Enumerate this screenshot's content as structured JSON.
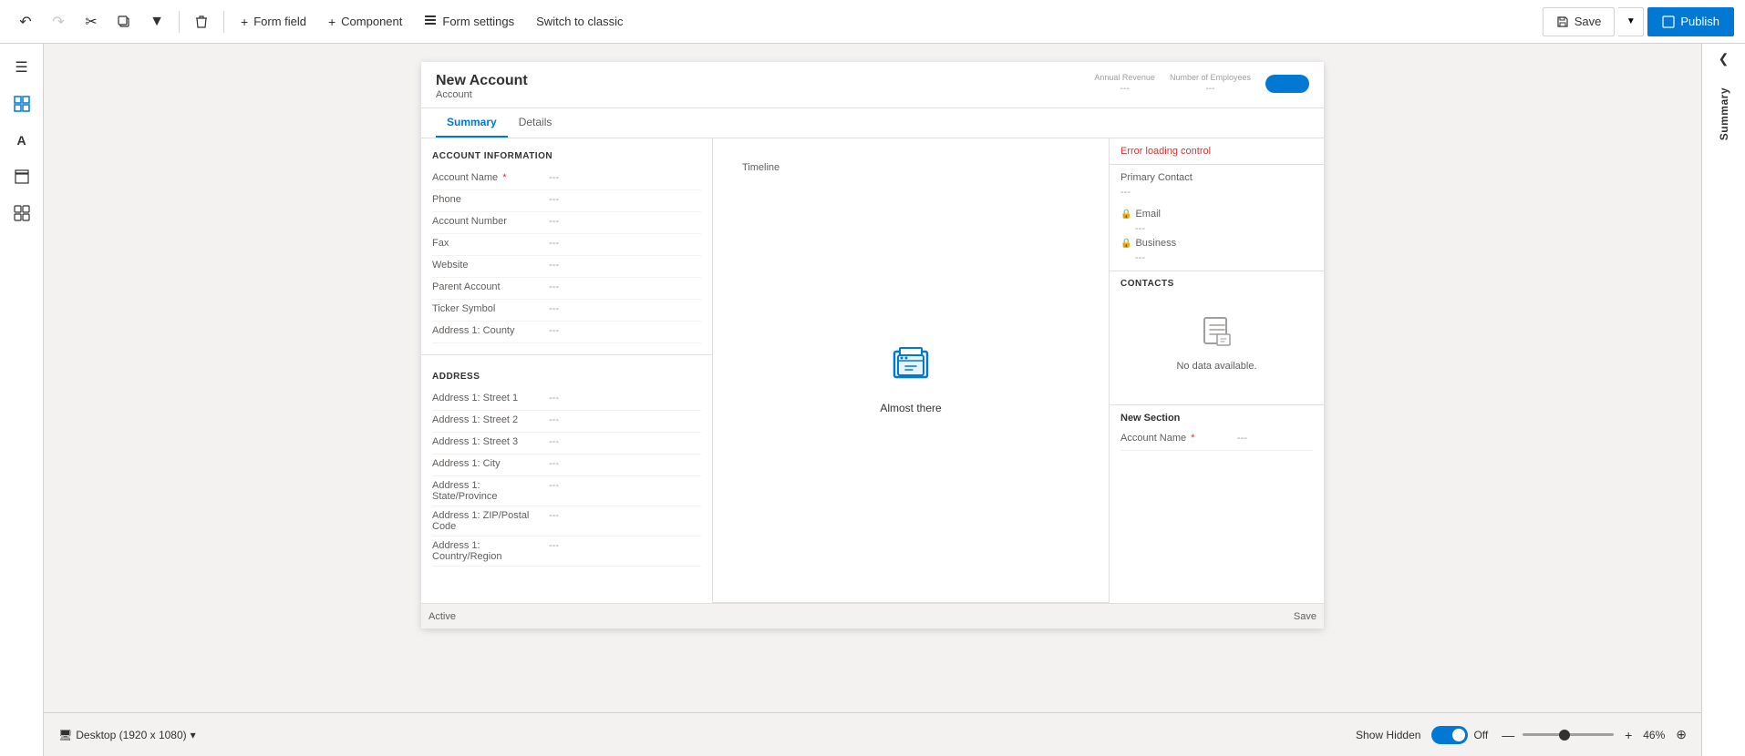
{
  "toolbar": {
    "undo_label": "↩",
    "redo_label": "↪",
    "cut_label": "✂",
    "copy_label": "⧉",
    "dropdown_label": "▾",
    "delete_label": "🗑",
    "form_field_label": "Form field",
    "component_label": "Component",
    "form_settings_label": "Form settings",
    "switch_classic_label": "Switch to classic",
    "save_label": "Save",
    "publish_label": "Publish"
  },
  "left_sidebar": {
    "icons": [
      {
        "name": "hamburger-icon",
        "symbol": "☰"
      },
      {
        "name": "grid-icon",
        "symbol": "▦"
      },
      {
        "name": "text-field-icon",
        "symbol": "A"
      },
      {
        "name": "layers-icon",
        "symbol": "◫"
      },
      {
        "name": "components-icon",
        "symbol": "⊞"
      }
    ]
  },
  "form": {
    "title": "New Account",
    "subtitle": "Account",
    "header_fields": [
      {
        "label": "Annual Revenue",
        "value": "---"
      },
      {
        "label": "Number of Employees",
        "value": "---"
      }
    ],
    "tabs": [
      {
        "label": "Summary",
        "active": true
      },
      {
        "label": "Details",
        "active": false
      }
    ],
    "sections": {
      "account_info": {
        "title": "ACCOUNT INFORMATION",
        "fields": [
          {
            "label": "Account Name",
            "required": true,
            "value": "---"
          },
          {
            "label": "Phone",
            "required": false,
            "value": "---"
          },
          {
            "label": "Account Number",
            "required": false,
            "value": "---"
          },
          {
            "label": "Fax",
            "required": false,
            "value": "---"
          },
          {
            "label": "Website",
            "required": false,
            "value": "---"
          },
          {
            "label": "Parent Account",
            "required": false,
            "value": "---"
          },
          {
            "label": "Ticker Symbol",
            "required": false,
            "value": "---"
          },
          {
            "label": "Address 1: County",
            "required": false,
            "value": "---"
          }
        ]
      },
      "address": {
        "title": "ADDRESS",
        "fields": [
          {
            "label": "Address 1: Street 1",
            "required": false,
            "value": "---"
          },
          {
            "label": "Address 1: Street 2",
            "required": false,
            "value": "---"
          },
          {
            "label": "Address 1: Street 3",
            "required": false,
            "value": "---"
          },
          {
            "label": "Address 1: City",
            "required": false,
            "value": "---"
          },
          {
            "label": "Address 1: State/Province",
            "required": false,
            "value": "---"
          },
          {
            "label": "Address 1: ZIP/Postal Code",
            "required": false,
            "value": "---"
          },
          {
            "label": "Address 1: Country/Region",
            "required": false,
            "value": "---"
          }
        ]
      }
    },
    "timeline": {
      "label": "Timeline",
      "icon": "📁",
      "text": "Almost there"
    },
    "right_panel": {
      "error_label": "Error loading control",
      "primary_contact_label": "Primary Contact",
      "primary_contact_value": "---",
      "email_label": "Email",
      "email_value": "---",
      "business_label": "Business",
      "business_value": "---",
      "contacts_title": "CONTACTS",
      "contacts_empty": "No data available.",
      "new_section_title": "New Section",
      "new_section_field_label": "Account Name",
      "new_section_field_required": true,
      "new_section_field_value": "---"
    }
  },
  "bottom_bar": {
    "desktop_label": "Desktop (1920 x 1080)",
    "dropdown_icon": "▾",
    "monitor_icon": "🖥",
    "show_hidden_label": "Show Hidden",
    "toggle_state": "Off",
    "zoom_minus": "—",
    "zoom_plus": "+",
    "zoom_percent": "46%",
    "zoom_fit_icon": "⊕",
    "status_left": "Active",
    "status_right": "Save"
  },
  "right_sidebar": {
    "close_icon": "❮",
    "label": "Summary"
  }
}
